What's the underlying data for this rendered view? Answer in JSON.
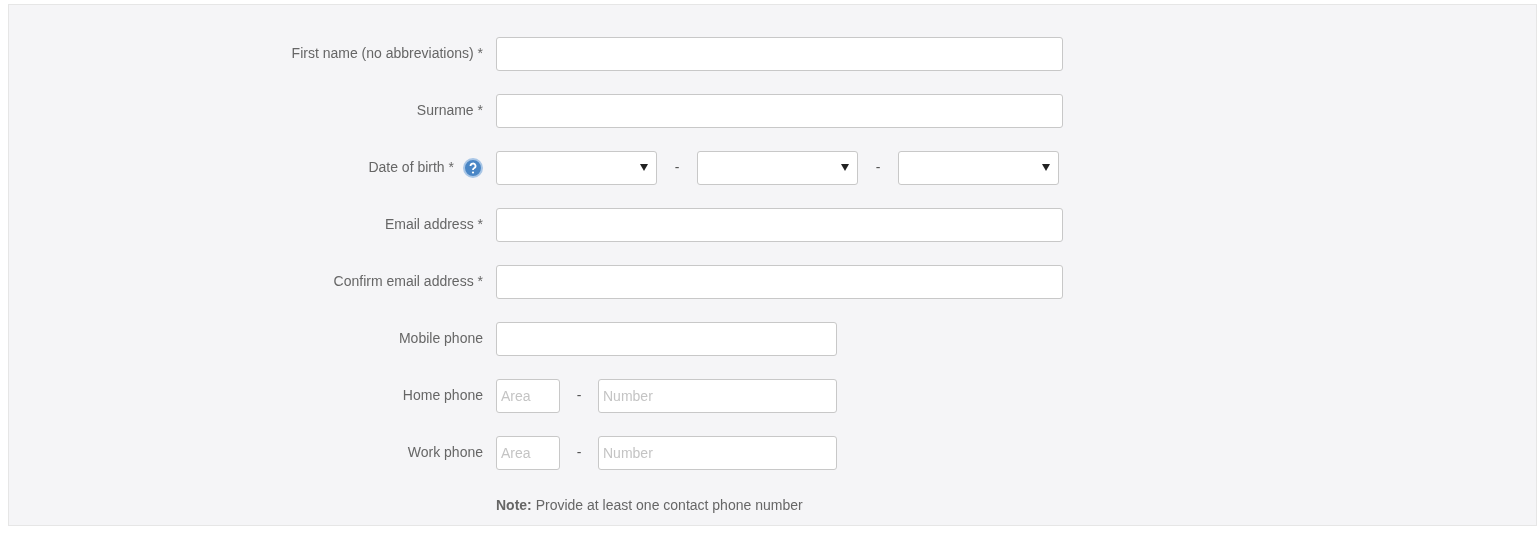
{
  "fields": [
    {
      "kind": "text",
      "label": "First name (no abbreviations) *",
      "help": false
    },
    {
      "kind": "text",
      "label": "Surname *",
      "help": false
    },
    {
      "kind": "date",
      "label": "Date of birth *",
      "help": true,
      "separators": [
        "-",
        "-"
      ]
    },
    {
      "kind": "text",
      "label": "Email address *",
      "help": false
    },
    {
      "kind": "text",
      "label": "Confirm email address *",
      "help": false
    },
    {
      "kind": "short_text",
      "label": "Mobile phone",
      "help": false
    },
    {
      "kind": "phone",
      "label": "Home phone",
      "help": false,
      "area_placeholder": "Area",
      "separator": "-",
      "number_placeholder": "Number"
    },
    {
      "kind": "phone",
      "label": "Work phone",
      "help": false,
      "area_placeholder": "Area",
      "separator": "-",
      "number_placeholder": "Number"
    }
  ],
  "note": "**Note:** Provide at least one contact phone number"
}
